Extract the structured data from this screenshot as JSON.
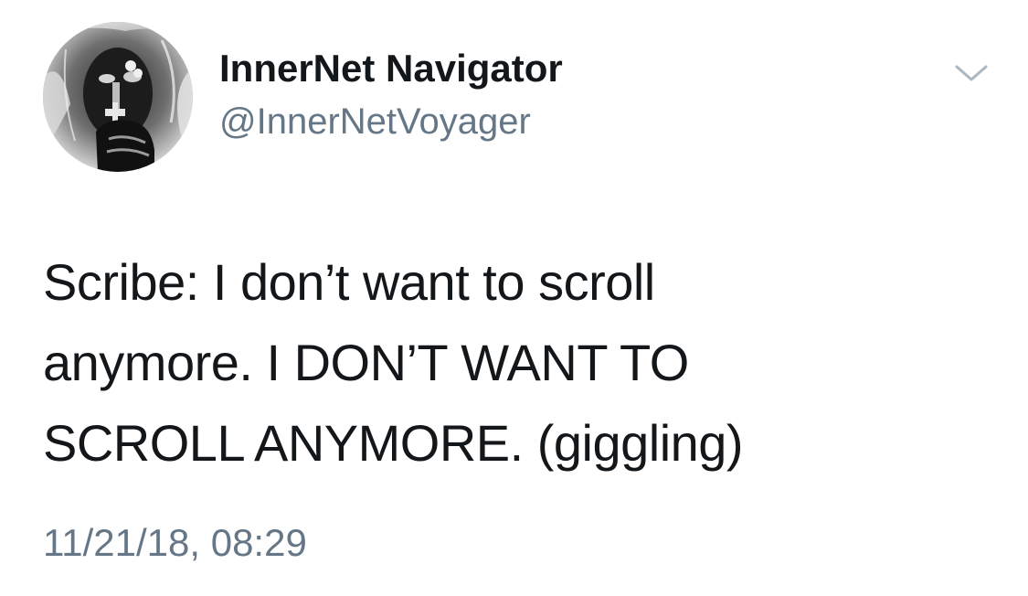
{
  "author": {
    "display_name": "InnerNet Navigator",
    "handle": "@InnerNetVoyager",
    "avatar_icon": "avatar-photo-inverted"
  },
  "tweet": {
    "text_lines": [
      "Scribe: I don’t want to scroll",
      "anymore. I DON’T WANT TO",
      "SCROLL ANYMORE. (giggling)"
    ],
    "timestamp": "11/21/18, 08:29"
  },
  "menu": {
    "icon": "chevron-down-icon"
  },
  "colors": {
    "primary_text": "#14171a",
    "secondary_text": "#657786",
    "caret": "#aab8c2",
    "background": "#ffffff"
  }
}
